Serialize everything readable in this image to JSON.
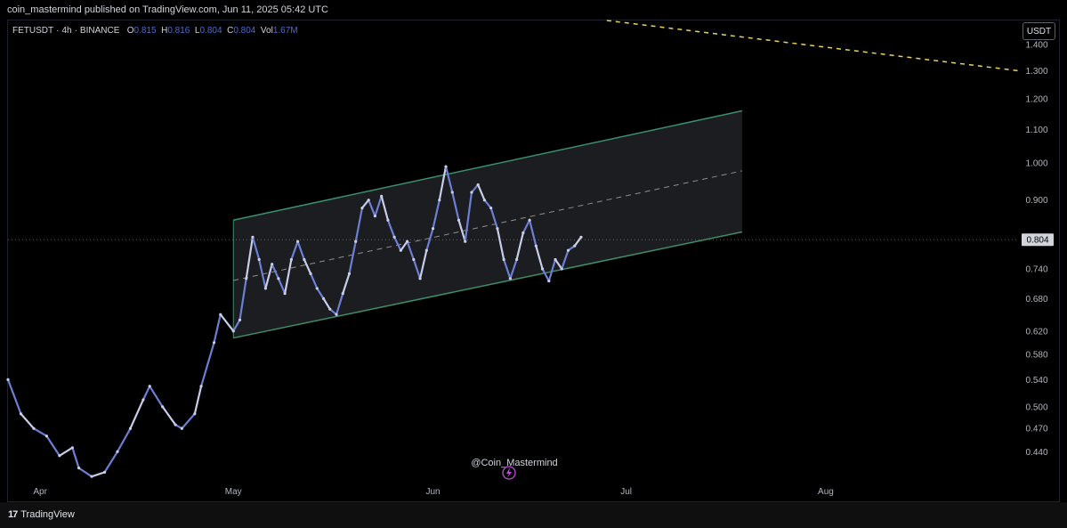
{
  "header": {
    "published_text": "coin_mastermind published on TradingView.com, Jun 11, 2025 05:42 UTC"
  },
  "legend": {
    "symbol": "FETUSDT",
    "interval": "4h",
    "exchange": "BINANCE",
    "open_label": "O",
    "open": "0.815",
    "high_label": "H",
    "high": "0.816",
    "low_label": "L",
    "low": "0.804",
    "close_label": "C",
    "close": "0.804",
    "vol_label": "Vol",
    "vol": "1.67M"
  },
  "currency_button": "USDT",
  "watermark": "@Coin_Mastermind",
  "footer": {
    "brand": "TradingView",
    "logo_icon": "tradingview-logo-icon"
  },
  "colors": {
    "candle": "#6d7fd4",
    "candle_light": "#c8cde8",
    "channel_line": "#3c8f6c",
    "channel_fill": "#1c1d20",
    "midline": "#8e8e8e",
    "trendline": "#e9d35b",
    "price_tag_bg": "#d1d4dc"
  },
  "chart_data": {
    "type": "line",
    "title": "",
    "xlabel": "",
    "ylabel": "",
    "y_scale": "log",
    "ylim": [
      0.405,
      1.5
    ],
    "x_range": [
      "2025-03-27",
      "2025-08-31"
    ],
    "x_tick_labels": [
      {
        "label": "Apr",
        "date": "2025-04-01"
      },
      {
        "label": "May",
        "date": "2025-05-01"
      },
      {
        "label": "Jun",
        "date": "2025-06-01"
      },
      {
        "label": "Jul",
        "date": "2025-07-01"
      },
      {
        "label": "Aug",
        "date": "2025-08-01"
      }
    ],
    "y_ticks": [
      "0.440",
      "0.470",
      "0.500",
      "0.540",
      "0.580",
      "0.620",
      "0.680",
      "0.740",
      "0.900",
      "1.000",
      "1.100",
      "1.200",
      "1.300",
      "1.400"
    ],
    "last_price": "0.804",
    "grid": false,
    "series": [
      {
        "points": [
          [
            "2025-03-27",
            0.54
          ],
          [
            "2025-03-29",
            0.49
          ],
          [
            "2025-03-31",
            0.47
          ],
          [
            "2025-04-02",
            0.46
          ],
          [
            "2025-04-04",
            0.435
          ],
          [
            "2025-04-06",
            0.445
          ],
          [
            "2025-04-07",
            0.42
          ],
          [
            "2025-04-09",
            0.41
          ],
          [
            "2025-04-11",
            0.415
          ],
          [
            "2025-04-13",
            0.44
          ],
          [
            "2025-04-15",
            0.47
          ],
          [
            "2025-04-17",
            0.51
          ],
          [
            "2025-04-18",
            0.53
          ],
          [
            "2025-04-20",
            0.5
          ],
          [
            "2025-04-22",
            0.475
          ],
          [
            "2025-04-23",
            0.47
          ],
          [
            "2025-04-25",
            0.49
          ],
          [
            "2025-04-26",
            0.53
          ],
          [
            "2025-04-28",
            0.6
          ],
          [
            "2025-04-29",
            0.65
          ],
          [
            "2025-05-01",
            0.62
          ],
          [
            "2025-05-02",
            0.64
          ],
          [
            "2025-05-03",
            0.72
          ],
          [
            "2025-05-04",
            0.81
          ],
          [
            "2025-05-05",
            0.76
          ],
          [
            "2025-05-06",
            0.7
          ],
          [
            "2025-05-07",
            0.75
          ],
          [
            "2025-05-08",
            0.72
          ],
          [
            "2025-05-09",
            0.69
          ],
          [
            "2025-05-10",
            0.76
          ],
          [
            "2025-05-11",
            0.8
          ],
          [
            "2025-05-12",
            0.76
          ],
          [
            "2025-05-13",
            0.73
          ],
          [
            "2025-05-14",
            0.7
          ],
          [
            "2025-05-15",
            0.68
          ],
          [
            "2025-05-16",
            0.66
          ],
          [
            "2025-05-17",
            0.65
          ],
          [
            "2025-05-18",
            0.69
          ],
          [
            "2025-05-19",
            0.73
          ],
          [
            "2025-05-20",
            0.8
          ],
          [
            "2025-05-21",
            0.88
          ],
          [
            "2025-05-22",
            0.9
          ],
          [
            "2025-05-23",
            0.86
          ],
          [
            "2025-05-24",
            0.91
          ],
          [
            "2025-05-25",
            0.85
          ],
          [
            "2025-05-26",
            0.81
          ],
          [
            "2025-05-27",
            0.78
          ],
          [
            "2025-05-28",
            0.8
          ],
          [
            "2025-05-29",
            0.76
          ],
          [
            "2025-05-30",
            0.72
          ],
          [
            "2025-05-31",
            0.78
          ],
          [
            "2025-06-01",
            0.83
          ],
          [
            "2025-06-02",
            0.9
          ],
          [
            "2025-06-03",
            0.99
          ],
          [
            "2025-06-04",
            0.92
          ],
          [
            "2025-06-05",
            0.85
          ],
          [
            "2025-06-06",
            0.8
          ],
          [
            "2025-06-07",
            0.92
          ],
          [
            "2025-06-08",
            0.94
          ],
          [
            "2025-06-09",
            0.9
          ],
          [
            "2025-06-10",
            0.88
          ],
          [
            "2025-06-11",
            0.83
          ],
          [
            "2025-06-12",
            0.76
          ],
          [
            "2025-06-13",
            0.72
          ],
          [
            "2025-06-14",
            0.76
          ],
          [
            "2025-06-15",
            0.82
          ],
          [
            "2025-06-16",
            0.85
          ],
          [
            "2025-06-17",
            0.79
          ],
          [
            "2025-06-18",
            0.74
          ],
          [
            "2025-06-19",
            0.715
          ],
          [
            "2025-06-20",
            0.76
          ],
          [
            "2025-06-21",
            0.74
          ],
          [
            "2025-06-22",
            0.78
          ],
          [
            "2025-06-23",
            0.79
          ],
          [
            "2025-06-24",
            0.81
          ]
        ]
      }
    ],
    "drawings": {
      "channel_upper": [
        [
          "2025-05-01",
          0.85
        ],
        [
          "2025-07-19",
          1.16
        ]
      ],
      "channel_lower": [
        [
          "2025-05-01",
          0.608
        ],
        [
          "2025-07-19",
          0.822
        ]
      ],
      "channel_mid": [
        [
          "2025-05-01",
          0.716
        ],
        [
          "2025-07-19",
          0.978
        ]
      ],
      "yellow_trendline": [
        [
          "2025-06-28",
          1.5
        ],
        [
          "2025-08-31",
          1.3
        ]
      ]
    }
  }
}
